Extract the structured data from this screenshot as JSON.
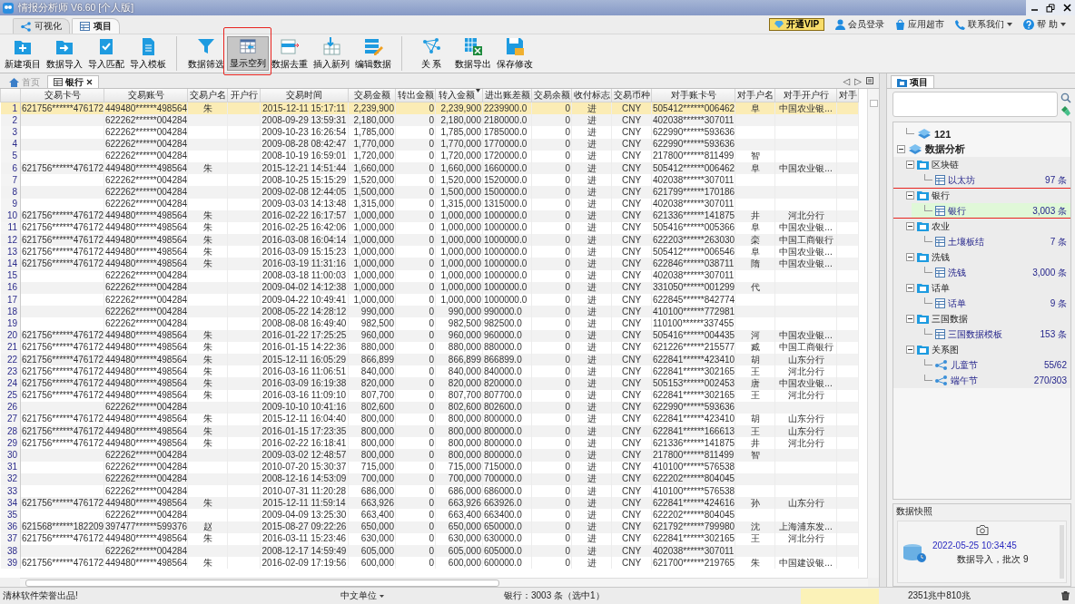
{
  "window": {
    "title": "情报分析师 V6.60 [个人版]"
  },
  "app_tabs": [
    {
      "label": "可视化",
      "kind": "share",
      "selected": false
    },
    {
      "label": "项目",
      "kind": "grid",
      "selected": true
    }
  ],
  "top_links": [
    {
      "label": "开通VIP",
      "kind": "vip",
      "dropdown": false
    },
    {
      "label": "会员登录",
      "kind": "user",
      "dropdown": false
    },
    {
      "label": "应用超市",
      "kind": "shop",
      "dropdown": false
    },
    {
      "label": "联系我们",
      "kind": "phone",
      "dropdown": true
    },
    {
      "label": "帮 助",
      "kind": "help",
      "dropdown": true
    }
  ],
  "toolbar": [
    {
      "label": "新建项目",
      "kind": "new",
      "pressed": false,
      "highlighted": false,
      "group_start": false
    },
    {
      "label": "数据导入",
      "kind": "import",
      "pressed": false,
      "highlighted": false,
      "group_start": false
    },
    {
      "label": "导入匹配",
      "kind": "match",
      "pressed": false,
      "highlighted": false,
      "group_start": false
    },
    {
      "label": "导入模板",
      "kind": "template",
      "pressed": false,
      "highlighted": false,
      "group_start": false
    },
    {
      "label": "数据筛选",
      "kind": "filter",
      "pressed": false,
      "highlighted": false,
      "group_start": true
    },
    {
      "label": "显示空列",
      "kind": "show-empty",
      "pressed": true,
      "highlighted": true,
      "group_start": false
    },
    {
      "label": "数据去重",
      "kind": "dedupe",
      "pressed": false,
      "highlighted": false,
      "group_start": false
    },
    {
      "label": "插入新列",
      "kind": "insert",
      "pressed": false,
      "highlighted": false,
      "group_start": false
    },
    {
      "label": "编辑数据",
      "kind": "edit",
      "pressed": false,
      "highlighted": false,
      "group_start": false
    },
    {
      "label": "关 系",
      "kind": "relation",
      "pressed": false,
      "highlighted": false,
      "group_start": true
    },
    {
      "label": "数据导出",
      "kind": "export",
      "pressed": false,
      "highlighted": false,
      "group_start": false
    },
    {
      "label": "保存修改",
      "kind": "save",
      "pressed": false,
      "highlighted": false,
      "group_start": false
    }
  ],
  "doc_tabs": [
    {
      "label": "首页",
      "kind": "home",
      "selected": false,
      "closable": false
    },
    {
      "label": "银行",
      "kind": "grid",
      "selected": true,
      "closable": true
    }
  ],
  "tab_nav": [
    "◁",
    "▷"
  ],
  "table": {
    "columns": [
      {
        "label": "交易卡号",
        "sorted": false
      },
      {
        "label": "交易账号",
        "sorted": false
      },
      {
        "label": "交易户名",
        "sorted": false
      },
      {
        "label": "开户行",
        "sorted": false
      },
      {
        "label": "交易时间",
        "sorted": false
      },
      {
        "label": "交易金额",
        "sorted": false
      },
      {
        "label": "转出金额",
        "sorted": false
      },
      {
        "label": "转入金额",
        "sorted": true
      },
      {
        "label": "进出账差额",
        "sorted": false
      },
      {
        "label": "交易余额",
        "sorted": false
      },
      {
        "label": "收付标志",
        "sorted": false
      },
      {
        "label": "交易币种",
        "sorted": false
      },
      {
        "label": "对手账卡号",
        "sorted": false
      },
      {
        "label": "对手户名",
        "sorted": false
      },
      {
        "label": "对手开户行",
        "sorted": false
      },
      {
        "label": "对手",
        "sorted": false
      }
    ],
    "rows": [
      {
        "n": "1",
        "selected": true,
        "cells": [
          "621756******476172",
          "449480******498564",
          "朱",
          null,
          "2015-12-11 15:17:11",
          "2,239,900",
          "0",
          "2,239,900",
          "2239900.0",
          "0",
          "进",
          "CNY",
          "505412******006462",
          "阜",
          "中国农业银...",
          null
        ]
      },
      {
        "n": "2",
        "selected": false,
        "cells": [
          null,
          "622262******004284",
          null,
          null,
          "2008-09-29 13:59:31",
          "2,180,000",
          "0",
          "2,180,000",
          "2180000.0",
          "0",
          "进",
          "CNY",
          "402038******307011",
          null,
          null,
          null
        ]
      },
      {
        "n": "3",
        "selected": false,
        "cells": [
          null,
          "622262******004284",
          null,
          null,
          "2009-10-23 16:26:54",
          "1,785,000",
          "0",
          "1,785,000",
          "1785000.0",
          "0",
          "进",
          "CNY",
          "622990******593636",
          null,
          null,
          null
        ]
      },
      {
        "n": "4",
        "selected": false,
        "cells": [
          null,
          "622262******004284",
          null,
          null,
          "2009-08-28 08:42:47",
          "1,770,000",
          "0",
          "1,770,000",
          "1770000.0",
          "0",
          "进",
          "CNY",
          "622990******593636",
          null,
          null,
          null
        ]
      },
      {
        "n": "5",
        "selected": false,
        "cells": [
          null,
          "622262******004284",
          null,
          null,
          "2008-10-19 16:59:01",
          "1,720,000",
          "0",
          "1,720,000",
          "1720000.0",
          "0",
          "进",
          "CNY",
          "217800******811499",
          "智",
          null,
          null
        ]
      },
      {
        "n": "6",
        "selected": false,
        "cells": [
          "621756******476172",
          "449480******498564",
          "朱",
          null,
          "2015-12-21 14:51:44",
          "1,660,000",
          "0",
          "1,660,000",
          "1660000.0",
          "0",
          "进",
          "CNY",
          "505412******006462",
          "阜",
          "中国农业银...",
          null
        ]
      },
      {
        "n": "7",
        "selected": false,
        "cells": [
          null,
          "622262******004284",
          null,
          null,
          "2008-10-25 15:15:29",
          "1,520,000",
          "0",
          "1,520,000",
          "1520000.0",
          "0",
          "进",
          "CNY",
          "402038******307011",
          null,
          null,
          null
        ]
      },
      {
        "n": "8",
        "selected": false,
        "cells": [
          null,
          "622262******004284",
          null,
          null,
          "2009-02-08 12:44:05",
          "1,500,000",
          "0",
          "1,500,000",
          "1500000.0",
          "0",
          "进",
          "CNY",
          "621799******170186",
          null,
          null,
          null
        ]
      },
      {
        "n": "9",
        "selected": false,
        "cells": [
          null,
          "622262******004284",
          null,
          null,
          "2009-03-03 14:13:48",
          "1,315,000",
          "0",
          "1,315,000",
          "1315000.0",
          "0",
          "进",
          "CNY",
          "402038******307011",
          null,
          null,
          null
        ]
      },
      {
        "n": "10",
        "selected": false,
        "cells": [
          "621756******476172",
          "449480******498564",
          "朱",
          null,
          "2016-02-22 16:17:57",
          "1,000,000",
          "0",
          "1,000,000",
          "1000000.0",
          "0",
          "进",
          "CNY",
          "621336******141875",
          "井",
          "河北分行",
          null
        ]
      },
      {
        "n": "11",
        "selected": false,
        "cells": [
          "621756******476172",
          "449480******498564",
          "朱",
          null,
          "2016-02-25 16:42:06",
          "1,000,000",
          "0",
          "1,000,000",
          "1000000.0",
          "0",
          "进",
          "CNY",
          "505416******005366",
          "阜",
          "中国农业银...",
          null
        ]
      },
      {
        "n": "12",
        "selected": false,
        "cells": [
          "621756******476172",
          "449480******498564",
          "朱",
          null,
          "2016-03-08 16:04:14",
          "1,000,000",
          "0",
          "1,000,000",
          "1000000.0",
          "0",
          "进",
          "CNY",
          "622203******263030",
          "栾",
          "中国工商银行",
          null
        ]
      },
      {
        "n": "13",
        "selected": false,
        "cells": [
          "621756******476172",
          "449480******498564",
          "朱",
          null,
          "2016-03-09 15:15:23",
          "1,000,000",
          "0",
          "1,000,000",
          "1000000.0",
          "0",
          "进",
          "CNY",
          "505412******006546",
          "阜",
          "中国农业银...",
          null
        ]
      },
      {
        "n": "14",
        "selected": false,
        "cells": [
          "621756******476172",
          "449480******498564",
          "朱",
          null,
          "2016-03-19 11:31:16",
          "1,000,000",
          "0",
          "1,000,000",
          "1000000.0",
          "0",
          "进",
          "CNY",
          "622846******038711",
          "隋",
          "中国农业银...",
          null
        ]
      },
      {
        "n": "15",
        "selected": false,
        "cells": [
          null,
          "622262******004284",
          null,
          null,
          "2008-03-18 11:00:03",
          "1,000,000",
          "0",
          "1,000,000",
          "1000000.0",
          "0",
          "进",
          "CNY",
          "402038******307011",
          null,
          null,
          null
        ]
      },
      {
        "n": "16",
        "selected": false,
        "cells": [
          null,
          "622262******004284",
          null,
          null,
          "2009-04-02 14:12:38",
          "1,000,000",
          "0",
          "1,000,000",
          "1000000.0",
          "0",
          "进",
          "CNY",
          "331050******001299",
          "代",
          null,
          null
        ]
      },
      {
        "n": "17",
        "selected": false,
        "cells": [
          null,
          "622262******004284",
          null,
          null,
          "2009-04-22 10:49:41",
          "1,000,000",
          "0",
          "1,000,000",
          "1000000.0",
          "0",
          "进",
          "CNY",
          "622845******842774",
          null,
          null,
          null
        ]
      },
      {
        "n": "18",
        "selected": false,
        "cells": [
          null,
          "622262******004284",
          null,
          null,
          "2008-05-22 14:28:12",
          "990,000",
          "0",
          "990,000",
          "990000.0",
          "0",
          "进",
          "CNY",
          "410100******772981",
          null,
          null,
          null
        ]
      },
      {
        "n": "19",
        "selected": false,
        "cells": [
          null,
          "622262******004284",
          null,
          null,
          "2008-08-08 16:49:40",
          "982,500",
          "0",
          "982,500",
          "982500.0",
          "0",
          "进",
          "CNY",
          "110100******337455",
          null,
          null,
          null
        ]
      },
      {
        "n": "20",
        "selected": false,
        "cells": [
          "621756******476172",
          "449480******498564",
          "朱",
          null,
          "2016-01-22 17:25:25",
          "960,000",
          "0",
          "960,000",
          "960000.0",
          "0",
          "进",
          "CNY",
          "505416******004435",
          "河",
          "中国农业银...",
          null
        ]
      },
      {
        "n": "21",
        "selected": false,
        "cells": [
          "621756******476172",
          "449480******498564",
          "朱",
          null,
          "2016-01-15 14:22:36",
          "880,000",
          "0",
          "880,000",
          "880000.0",
          "0",
          "进",
          "CNY",
          "621226******215577",
          "臧",
          "中国工商银行",
          null
        ]
      },
      {
        "n": "22",
        "selected": false,
        "cells": [
          "621756******476172",
          "449480******498564",
          "朱",
          null,
          "2015-12-11 16:05:29",
          "866,899",
          "0",
          "866,899",
          "866899.0",
          "0",
          "进",
          "CNY",
          "622841******423410",
          "胡",
          "山东分行",
          null
        ]
      },
      {
        "n": "23",
        "selected": false,
        "cells": [
          "621756******476172",
          "449480******498564",
          "朱",
          null,
          "2016-03-16 11:06:51",
          "840,000",
          "0",
          "840,000",
          "840000.0",
          "0",
          "进",
          "CNY",
          "622841******302165",
          "王",
          "河北分行",
          null
        ]
      },
      {
        "n": "24",
        "selected": false,
        "cells": [
          "621756******476172",
          "449480******498564",
          "朱",
          null,
          "2016-03-09 16:19:38",
          "820,000",
          "0",
          "820,000",
          "820000.0",
          "0",
          "进",
          "CNY",
          "505153******002453",
          "唐",
          "中国农业银...",
          null
        ]
      },
      {
        "n": "25",
        "selected": false,
        "cells": [
          "621756******476172",
          "449480******498564",
          "朱",
          null,
          "2016-03-16 11:09:10",
          "807,700",
          "0",
          "807,700",
          "807700.0",
          "0",
          "进",
          "CNY",
          "622841******302165",
          "王",
          "河北分行",
          null
        ]
      },
      {
        "n": "26",
        "selected": false,
        "cells": [
          null,
          "622262******004284",
          null,
          null,
          "2009-10-10 10:41:16",
          "802,600",
          "0",
          "802,600",
          "802600.0",
          "0",
          "进",
          "CNY",
          "622990******593636",
          null,
          null,
          null
        ]
      },
      {
        "n": "27",
        "selected": false,
        "cells": [
          "621756******476172",
          "449480******498564",
          "朱",
          null,
          "2015-12-11 16:04:40",
          "800,000",
          "0",
          "800,000",
          "800000.0",
          "0",
          "进",
          "CNY",
          "622841******423410",
          "胡",
          "山东分行",
          null
        ]
      },
      {
        "n": "28",
        "selected": false,
        "cells": [
          "621756******476172",
          "449480******498564",
          "朱",
          null,
          "2016-01-15 17:23:35",
          "800,000",
          "0",
          "800,000",
          "800000.0",
          "0",
          "进",
          "CNY",
          "622841******166613",
          "王",
          "山东分行",
          null
        ]
      },
      {
        "n": "29",
        "selected": false,
        "cells": [
          "621756******476172",
          "449480******498564",
          "朱",
          null,
          "2016-02-22 16:18:41",
          "800,000",
          "0",
          "800,000",
          "800000.0",
          "0",
          "进",
          "CNY",
          "621336******141875",
          "井",
          "河北分行",
          null
        ]
      },
      {
        "n": "30",
        "selected": false,
        "cells": [
          null,
          "622262******004284",
          null,
          null,
          "2009-03-02 12:48:57",
          "800,000",
          "0",
          "800,000",
          "800000.0",
          "0",
          "进",
          "CNY",
          "217800******811499",
          "智",
          null,
          null
        ]
      },
      {
        "n": "31",
        "selected": false,
        "cells": [
          null,
          "622262******004284",
          null,
          null,
          "2010-07-20 15:30:37",
          "715,000",
          "0",
          "715,000",
          "715000.0",
          "0",
          "进",
          "CNY",
          "410100******576538",
          null,
          null,
          null
        ]
      },
      {
        "n": "32",
        "selected": false,
        "cells": [
          null,
          "622262******004284",
          null,
          null,
          "2008-12-16 14:53:09",
          "700,000",
          "0",
          "700,000",
          "700000.0",
          "0",
          "进",
          "CNY",
          "622202******804045",
          null,
          null,
          null
        ]
      },
      {
        "n": "33",
        "selected": false,
        "cells": [
          null,
          "622262******004284",
          null,
          null,
          "2010-07-31 11:20:28",
          "686,000",
          "0",
          "686,000",
          "686000.0",
          "0",
          "进",
          "CNY",
          "410100******576538",
          null,
          null,
          null
        ]
      },
      {
        "n": "34",
        "selected": false,
        "cells": [
          "621756******476172",
          "449480******498564",
          "朱",
          null,
          "2015-12-11 11:59:14",
          "663,926",
          "0",
          "663,926",
          "663926.0",
          "0",
          "进",
          "CNY",
          "622841******424616",
          "孙",
          "山东分行",
          null
        ]
      },
      {
        "n": "35",
        "selected": false,
        "cells": [
          null,
          "622262******004284",
          null,
          null,
          "2009-04-09 13:25:30",
          "663,400",
          "0",
          "663,400",
          "663400.0",
          "0",
          "进",
          "CNY",
          "622202******804045",
          null,
          null,
          null
        ]
      },
      {
        "n": "36",
        "selected": false,
        "cells": [
          "621568******182209",
          "397477******599376",
          "赵",
          null,
          "2015-08-27 09:22:26",
          "650,000",
          "0",
          "650,000",
          "650000.0",
          "0",
          "进",
          "CNY",
          "621792******799980",
          "沈",
          "上海浦东发...",
          null
        ]
      },
      {
        "n": "37",
        "selected": false,
        "cells": [
          "621756******476172",
          "449480******498564",
          "朱",
          null,
          "2016-03-11 15:23:46",
          "630,000",
          "0",
          "630,000",
          "630000.0",
          "0",
          "进",
          "CNY",
          "622841******302165",
          "王",
          "河北分行",
          null
        ]
      },
      {
        "n": "38",
        "selected": false,
        "cells": [
          null,
          "622262******004284",
          null,
          null,
          "2008-12-17 14:59:49",
          "605,000",
          "0",
          "605,000",
          "605000.0",
          "0",
          "进",
          "CNY",
          "402038******307011",
          null,
          null,
          null
        ]
      },
      {
        "n": "39",
        "selected": false,
        "cells": [
          "621756******476172",
          "449480******498564",
          "朱",
          null,
          "2016-02-09 17:19:56",
          "600,000",
          "0",
          "600,000",
          "600000.0",
          "0",
          "进",
          "CNY",
          "621700******219765",
          "朱",
          "中国建设银...",
          null
        ]
      }
    ]
  },
  "side_panel": {
    "tab": "项目",
    "tree": [
      {
        "label": "121",
        "kind": "book",
        "selected": false
      },
      {
        "label": "数据分析",
        "kind": "book",
        "selected": false,
        "expanded": true,
        "children": [
          {
            "label": "区块链",
            "kind": "folder",
            "selected": false,
            "expanded": true,
            "children": [
              {
                "label": "以太坊",
                "kind": "table",
                "count": "97 条",
                "selected": false
              }
            ]
          },
          {
            "label": "银行",
            "kind": "folder",
            "selected": false,
            "highlighted": true,
            "expanded": true,
            "children": [
              {
                "label": "银行",
                "kind": "table",
                "count": "3,003 条",
                "selected": true
              }
            ]
          },
          {
            "label": "农业",
            "kind": "folder",
            "selected": false,
            "expanded": true,
            "children": [
              {
                "label": "土壤板结",
                "kind": "table",
                "count": "7 条",
                "selected": false
              }
            ]
          },
          {
            "label": "洗钱",
            "kind": "folder",
            "selected": false,
            "expanded": true,
            "children": [
              {
                "label": "洗钱",
                "kind": "table",
                "count": "3,000 条",
                "selected": false
              }
            ]
          },
          {
            "label": "话单",
            "kind": "folder",
            "selected": false,
            "expanded": true,
            "children": [
              {
                "label": "话单",
                "kind": "table",
                "count": "9 条",
                "selected": false
              }
            ]
          },
          {
            "label": "三国数据",
            "kind": "folder",
            "selected": false,
            "expanded": true,
            "children": [
              {
                "label": "三国数据模板",
                "kind": "table",
                "count": "153 条",
                "selected": false
              }
            ]
          },
          {
            "label": "关系图",
            "kind": "folder",
            "selected": false,
            "expanded": true,
            "children": [
              {
                "label": "儿童节",
                "kind": "graph",
                "count": "55/62",
                "selected": false
              },
              {
                "label": "端午节",
                "kind": "graph",
                "count": "270/303",
                "selected": false
              }
            ]
          }
        ]
      }
    ],
    "snapshot": {
      "title": "数据快照",
      "time": "2022-05-25 10:34:45",
      "description": "数据导入，批次 9"
    }
  },
  "status_bar": {
    "credit": "清林软件荣誉出品!",
    "unit": "中文单位",
    "table_info": "银行：3003 条（选中1）",
    "memory": "2351兆中810兆"
  }
}
